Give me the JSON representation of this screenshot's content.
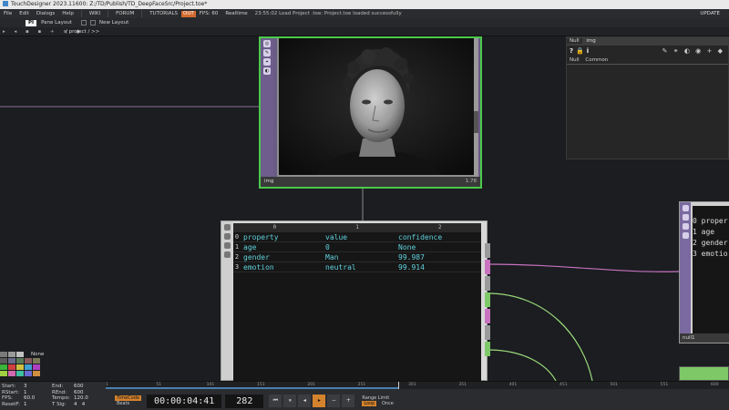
{
  "window": {
    "title": "TouchDesigner 2023.11600: Z:/TD/Publish/TD_DeepFaceSrc/Project.toe*"
  },
  "menubar": {
    "items": [
      "File",
      "Edit",
      "Dialogs",
      "Help"
    ],
    "wiki": "WIKI",
    "forum": "FORUM",
    "tutorials": "TUTORIALS",
    "out_badge": "OUT",
    "fps": "FPS: 60",
    "realtime": "Realtime",
    "status": "23:55:02 Load Project .toe: Project.toe loaded successfully",
    "update": "UPDATE"
  },
  "panebar": {
    "pi": "PI",
    "pane_layout": "Pane Layout",
    "new_layout": "New Layout"
  },
  "pathbar": {
    "path": "/ project / >>"
  },
  "node_img": {
    "name": "img",
    "resolution": "1.78"
  },
  "node_table": {
    "col_headers": [
      "0",
      "1",
      "2"
    ],
    "rows": [
      {
        "index": "0",
        "cells": [
          "property",
          "value",
          "confidence"
        ]
      },
      {
        "index": "1",
        "cells": [
          "age",
          "0",
          "None"
        ]
      },
      {
        "index": "2",
        "cells": [
          "gender",
          "Man",
          "99.987"
        ]
      },
      {
        "index": "3",
        "cells": [
          "emotion",
          "neutral",
          "99.914"
        ]
      }
    ]
  },
  "param": {
    "tab1": "Null",
    "tab2": "img",
    "sub1": "Null",
    "sub2": "Common"
  },
  "node_null": {
    "name": "null1",
    "rows": [
      {
        "index": "0",
        "text": "proper"
      },
      {
        "index": "1",
        "text": "age"
      },
      {
        "index": "2",
        "text": "gender"
      },
      {
        "index": "3",
        "text": "emotio"
      }
    ]
  },
  "palette": {
    "none_label": "None"
  },
  "stats": {
    "start": "3",
    "rstart": "1",
    "fps": "60.0",
    "resetf": "1",
    "end": "600",
    "rend": "600",
    "tempo": "120.0",
    "tsig1": "4",
    "tsig2": "4"
  },
  "stats_labels": {
    "start": "Start:",
    "rstart": "RStart:",
    "fps": "FPS:",
    "resetf": "ResetF:",
    "end": "End:",
    "rend": "REnd:",
    "tempo": "Tempo:",
    "tsig": "T Sig:"
  },
  "ruler": {
    "ticks": [
      "1",
      "51",
      "101",
      "151",
      "201",
      "251",
      "301",
      "351",
      "401",
      "451",
      "501",
      "551",
      "600"
    ]
  },
  "timeline": {
    "timecode_label": "TimeCode",
    "beats_label": "Beats",
    "timecode": "00:00:04:41",
    "frame": "282",
    "range_limit": "Range Limit",
    "loop": "Loop",
    "once": "Once",
    "progress": 0.47
  },
  "colors": {
    "accent": "#d4822d",
    "node_active": "#4cc94c",
    "cell_text": "#5fd0dc",
    "wire": "#b78fc8",
    "wire_green": "#9bdb7b"
  }
}
